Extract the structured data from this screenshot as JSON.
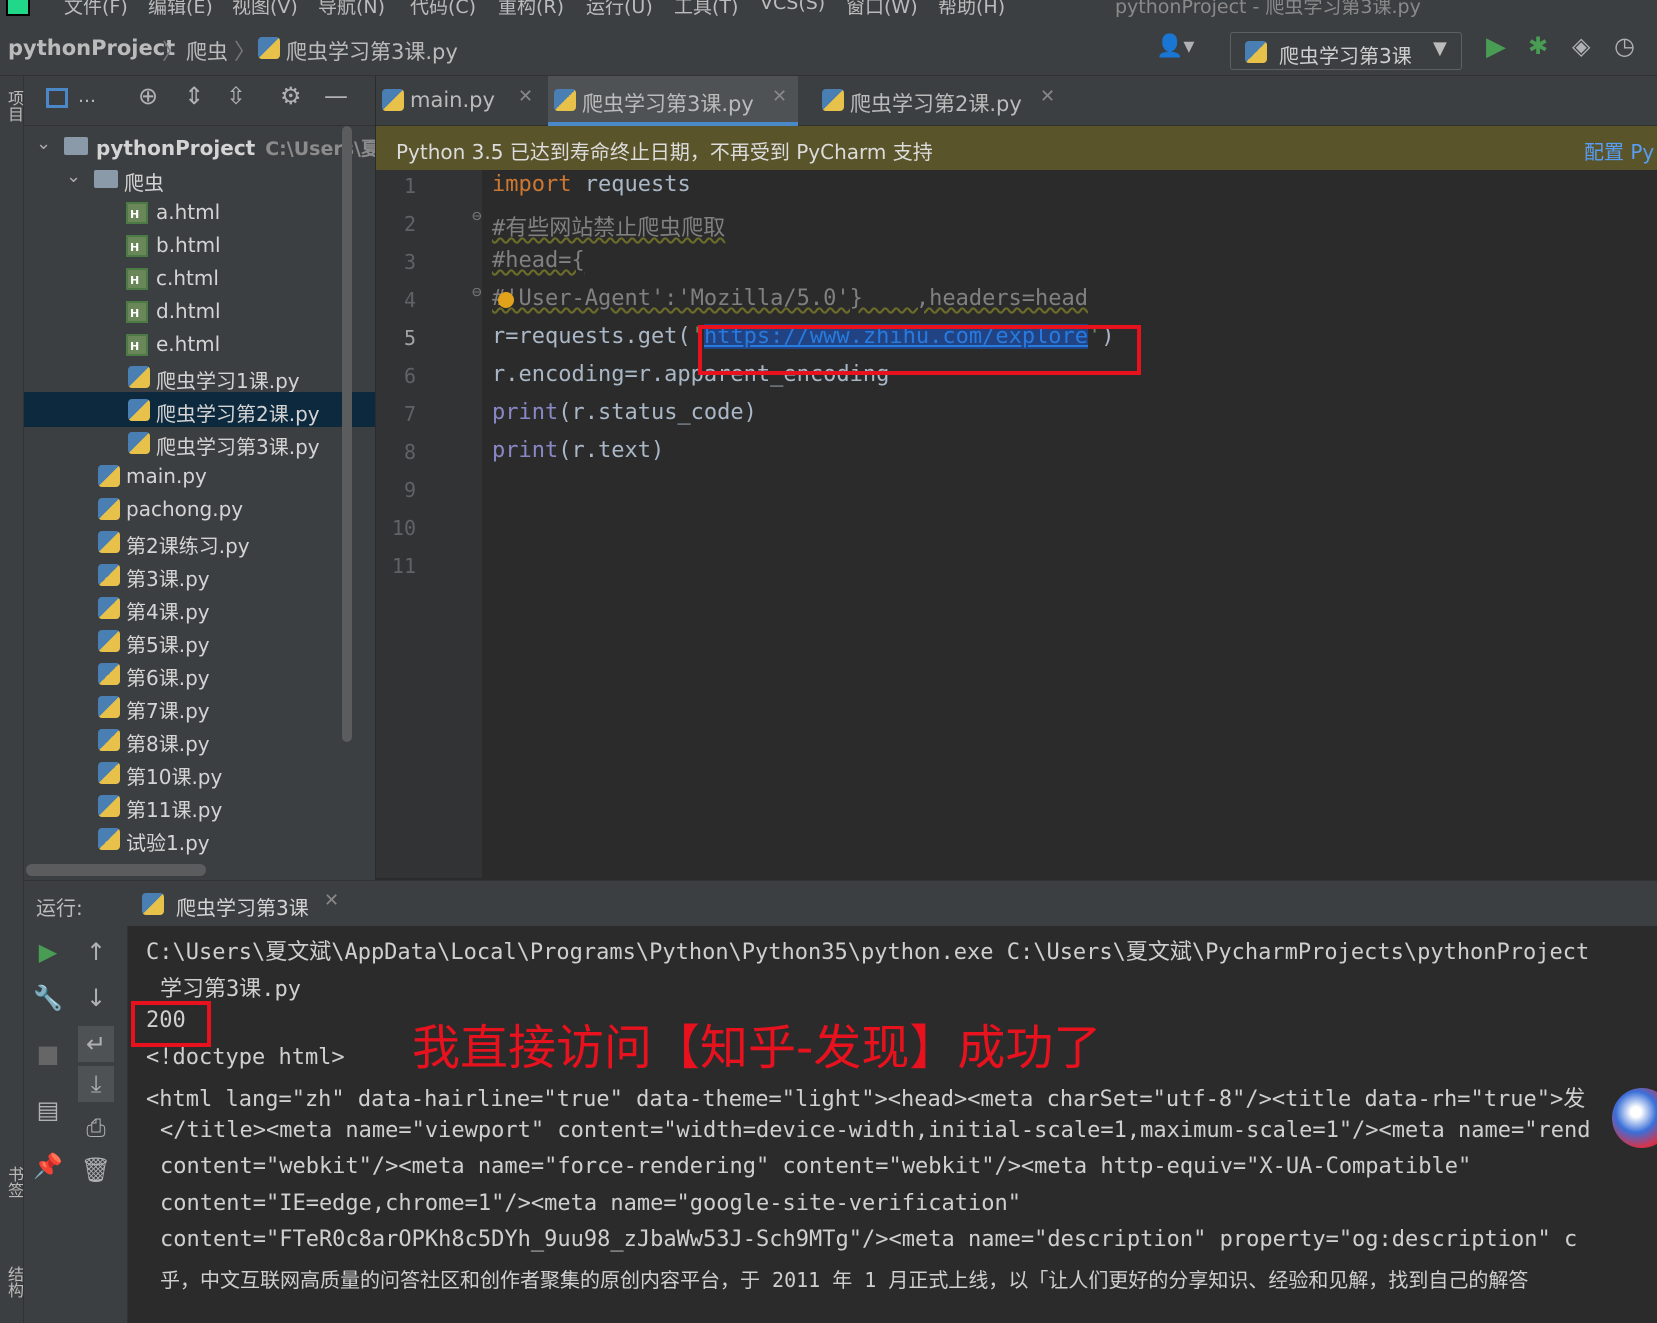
{
  "menu": {
    "items": [
      "文件(F)",
      "编辑(E)",
      "视图(V)",
      "导航(N)",
      "代码(C)",
      "重构(R)",
      "运行(U)",
      "工具(T)",
      "VCS(S)",
      "窗口(W)",
      "帮助(H)"
    ],
    "window_title": "pythonProject - 爬虫学习第3课.py"
  },
  "navbar": {
    "breadcrumbs": [
      "pythonProject",
      "爬虫",
      "爬虫学习第3课.py"
    ],
    "run_config": "爬虫学习第3课"
  },
  "left_strip": {
    "top_label": "项目",
    "mid_label": "书签",
    "bottom_label": "结构"
  },
  "project": {
    "root_name": "pythonProject",
    "root_path": "C:\\Users\\夏",
    "folder": "爬虫",
    "folder_files": [
      "a.html",
      "b.html",
      "c.html",
      "d.html",
      "e.html",
      "爬虫学习1课.py",
      "爬虫学习第2课.py",
      "爬虫学习第3课.py"
    ],
    "root_files": [
      "main.py",
      "pachong.py",
      "第2课练习.py",
      "第3课.py",
      "第4课.py",
      "第5课.py",
      "第6课.py",
      "第7课.py",
      "第8课.py",
      "第10课.py",
      "第11课.py",
      "试验1.py"
    ],
    "selected": "爬虫学习第2课.py"
  },
  "tabs": [
    {
      "label": "main.py",
      "active": false
    },
    {
      "label": "爬虫学习第3课.py",
      "active": true
    },
    {
      "label": "爬虫学习第2课.py",
      "active": false
    }
  ],
  "banner": {
    "text": "Python 3.5 已达到寿命终止日期，不再受到 PyCharm 支持",
    "link": "配置 Py"
  },
  "editor": {
    "line_numbers": [
      "1",
      "2",
      "3",
      "4",
      "5",
      "6",
      "7",
      "8",
      "9",
      "10",
      "11"
    ],
    "current_line": "5",
    "code": {
      "l1_kw": "import",
      "l1_rest": " requests",
      "l2": "#有些网站禁止爬虫爬取",
      "l3": "#head={",
      "l4": "#'User-Agent':'Mozilla/5.0'}    ,headers=head",
      "l5_pre": "r=requests.get(",
      "l5_q1": "'",
      "l5_url": "https://www.zhihu.com/explore",
      "l5_q2": "'",
      "l5_post": ")",
      "l6": "r.encoding=r.apparent_encoding",
      "l7_fn": "print",
      "l7_rest": "(r.status_code)",
      "l8_fn": "print",
      "l8_rest": "(r.text)"
    }
  },
  "run": {
    "title": "运行:",
    "tab": "爬虫学习第3课",
    "console": [
      "C:\\Users\\夏文斌\\AppData\\Local\\Programs\\Python\\Python35\\python.exe C:\\Users\\夏文斌\\PycharmProjects\\pythonProject",
      "学习第3课.py",
      "200",
      "<!doctype html>",
      "<html lang=\"zh\" data-hairline=\"true\" data-theme=\"light\"><head><meta charSet=\"utf-8\"/><title data-rh=\"true\">发",
      "</title><meta name=\"viewport\" content=\"width=device-width,initial-scale=1,maximum-scale=1\"/><meta name=\"rend",
      "content=\"webkit\"/><meta name=\"force-rendering\" content=\"webkit\"/><meta http-equiv=\"X-UA-Compatible\"",
      "content=\"IE=edge,chrome=1\"/><meta name=\"google-site-verification\"",
      "content=\"FTeR0c8arOPKh8c5DYh_9uu98_zJbaWw53J-Sch9MTg\"/><meta name=\"description\" property=\"og:description\" c",
      "乎，中文互联网高质量的问答社区和创作者聚集的原创内容平台，于 2011 年 1 月正式上线，以「让人们更好的分享知识、经验和见解，找到自己的解答"
    ],
    "annotation": "我直接访问【知乎-发现】成功了"
  },
  "colors": {
    "annotation_red": "#e8121e",
    "selection_blue": "#0d293e",
    "banner_olive": "#59542a"
  }
}
